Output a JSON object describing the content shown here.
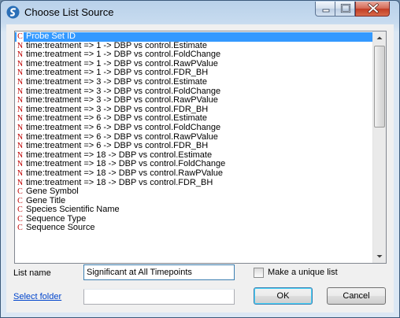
{
  "window": {
    "title": "Choose List Source"
  },
  "list": {
    "items": [
      {
        "badge": "C",
        "label": "Probe Set ID",
        "selected": true
      },
      {
        "badge": "N",
        "label": "time:treatment => 1 -> DBP vs control.Estimate"
      },
      {
        "badge": "N",
        "label": "time:treatment => 1 -> DBP vs control.FoldChange"
      },
      {
        "badge": "N",
        "label": "time:treatment => 1 -> DBP vs control.RawPValue"
      },
      {
        "badge": "N",
        "label": "time:treatment => 1 -> DBP vs control.FDR_BH"
      },
      {
        "badge": "N",
        "label": "time:treatment => 3 -> DBP vs control.Estimate"
      },
      {
        "badge": "N",
        "label": "time:treatment => 3 -> DBP vs control.FoldChange"
      },
      {
        "badge": "N",
        "label": "time:treatment => 3 -> DBP vs control.RawPValue"
      },
      {
        "badge": "N",
        "label": "time:treatment => 3 -> DBP vs control.FDR_BH"
      },
      {
        "badge": "N",
        "label": "time:treatment => 6 -> DBP vs control.Estimate"
      },
      {
        "badge": "N",
        "label": "time:treatment => 6 -> DBP vs control.FoldChange"
      },
      {
        "badge": "N",
        "label": "time:treatment => 6 -> DBP vs control.RawPValue"
      },
      {
        "badge": "N",
        "label": "time:treatment => 6 -> DBP vs control.FDR_BH"
      },
      {
        "badge": "N",
        "label": "time:treatment => 18 -> DBP vs control.Estimate"
      },
      {
        "badge": "N",
        "label": "time:treatment => 18 -> DBP vs control.FoldChange"
      },
      {
        "badge": "N",
        "label": "time:treatment => 18 -> DBP vs control.RawPValue"
      },
      {
        "badge": "N",
        "label": "time:treatment => 18 -> DBP vs control.FDR_BH"
      },
      {
        "badge": "C",
        "label": "Gene Symbol"
      },
      {
        "badge": "C",
        "label": "Gene Title"
      },
      {
        "badge": "C",
        "label": "Species Scientific Name"
      },
      {
        "badge": "C",
        "label": "Sequence Type"
      },
      {
        "badge": "C",
        "label": "Sequence Source"
      }
    ]
  },
  "form": {
    "list_name_label": "List name",
    "list_name_value": "Significant at All Timepoints",
    "select_folder_label": "Select folder",
    "folder_value": "",
    "unique_label": "Make a unique list",
    "ok_label": "OK",
    "cancel_label": "Cancel"
  },
  "colors": {
    "selection": "#3399ff",
    "badge": "#c00000",
    "link": "#0044cc"
  }
}
